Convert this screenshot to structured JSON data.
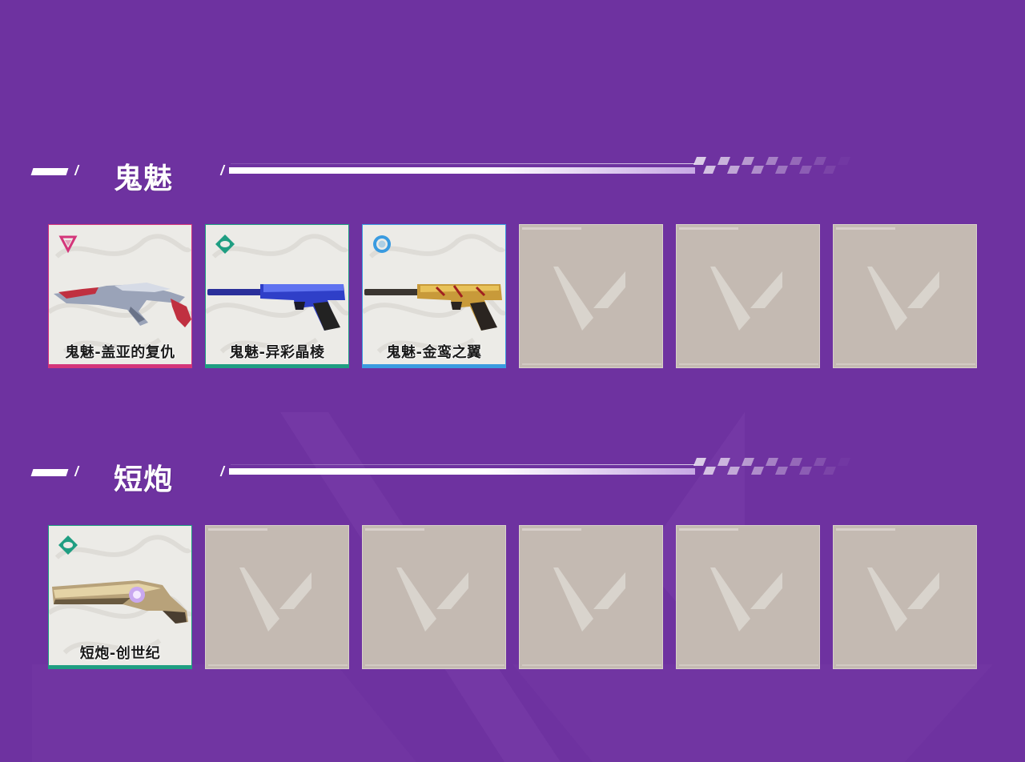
{
  "sections": [
    {
      "title": "鬼魅",
      "slots": [
        {
          "name": "鬼魅-盖亚的复仇",
          "rarity": "exclusive",
          "rarity_icon": "triangle-rarity-icon",
          "color": "#d4357a"
        },
        {
          "name": "鬼魅-异彩晶棱",
          "rarity": "deluxe",
          "rarity_icon": "diamond-rarity-icon",
          "color": "#1f9e82"
        },
        {
          "name": "鬼魅-金鸾之翼",
          "rarity": "select",
          "rarity_icon": "ring-rarity-icon",
          "color": "#3a9be0"
        },
        {
          "empty": true
        },
        {
          "empty": true
        },
        {
          "empty": true
        }
      ]
    },
    {
      "title": "短炮",
      "slots": [
        {
          "name": "短炮-创世纪",
          "rarity": "deluxe",
          "rarity_icon": "diamond-rarity-icon",
          "color": "#1f9e82"
        },
        {
          "empty": true
        },
        {
          "empty": true
        },
        {
          "empty": true
        },
        {
          "empty": true
        },
        {
          "empty": true
        }
      ]
    }
  ],
  "colors": {
    "background": "#6e32a0",
    "empty_slot": "#c4bab2",
    "filled_slot": "#ecebe7"
  }
}
